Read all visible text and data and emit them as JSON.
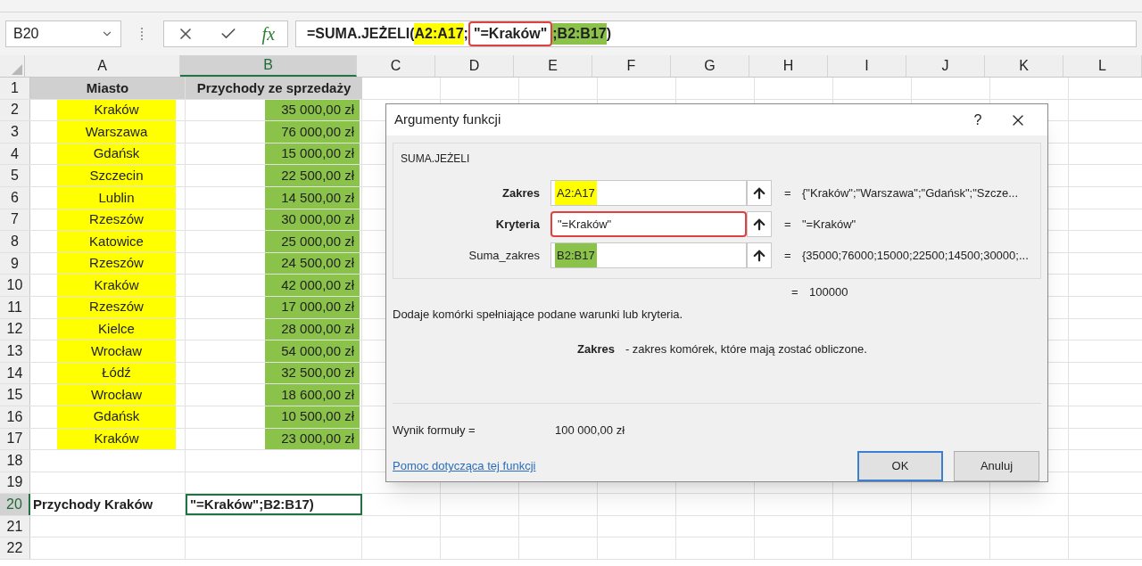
{
  "formula_bar": {
    "name_box": "B20",
    "fx": "fx",
    "formula": [
      {
        "text": "=SUMA.JEŻELI(",
        "kind": "plain"
      },
      {
        "text": "A2:A17",
        "kind": "yellow"
      },
      {
        "text": ";",
        "kind": "plain"
      },
      {
        "text": "\"=Kraków\"",
        "kind": "outlined"
      },
      {
        "text": ";B2:B17",
        "kind": "green"
      },
      {
        "text": ")",
        "kind": "plain"
      }
    ]
  },
  "columns": [
    {
      "label": "A",
      "selected": false
    },
    {
      "label": "B",
      "selected": true
    },
    {
      "label": "C",
      "selected": false
    },
    {
      "label": "D",
      "selected": false
    },
    {
      "label": "E",
      "selected": false
    },
    {
      "label": "F",
      "selected": false
    },
    {
      "label": "G",
      "selected": false
    },
    {
      "label": "H",
      "selected": false
    },
    {
      "label": "I",
      "selected": false
    },
    {
      "label": "J",
      "selected": false
    },
    {
      "label": "K",
      "selected": false
    },
    {
      "label": "L",
      "selected": false
    }
  ],
  "rows": [
    {
      "row": "1",
      "kind": "header",
      "selected": false,
      "a": "Miasto",
      "b": "Przychody ze sprzedaży"
    },
    {
      "row": "2",
      "kind": "data",
      "selected": false,
      "a": "Kraków",
      "b": "35 000,00 zł"
    },
    {
      "row": "3",
      "kind": "data",
      "selected": false,
      "a": "Warszawa",
      "b": "76 000,00 zł"
    },
    {
      "row": "4",
      "kind": "data",
      "selected": false,
      "a": "Gdańsk",
      "b": "15 000,00 zł"
    },
    {
      "row": "5",
      "kind": "data",
      "selected": false,
      "a": "Szczecin",
      "b": "22 500,00 zł"
    },
    {
      "row": "6",
      "kind": "data",
      "selected": false,
      "a": "Lublin",
      "b": "14 500,00 zł"
    },
    {
      "row": "7",
      "kind": "data",
      "selected": false,
      "a": "Rzeszów",
      "b": "30 000,00 zł"
    },
    {
      "row": "8",
      "kind": "data",
      "selected": false,
      "a": "Katowice",
      "b": "25 000,00 zł"
    },
    {
      "row": "9",
      "kind": "data",
      "selected": false,
      "a": "Rzeszów",
      "b": "24 500,00 zł"
    },
    {
      "row": "10",
      "kind": "data",
      "selected": false,
      "a": "Kraków",
      "b": "42 000,00 zł"
    },
    {
      "row": "11",
      "kind": "data",
      "selected": false,
      "a": "Rzeszów",
      "b": "17 000,00 zł"
    },
    {
      "row": "12",
      "kind": "data",
      "selected": false,
      "a": "Kielce",
      "b": "28 000,00 zł"
    },
    {
      "row": "13",
      "kind": "data",
      "selected": false,
      "a": "Wrocław",
      "b": "54 000,00 zł"
    },
    {
      "row": "14",
      "kind": "data",
      "selected": false,
      "a": "Łódź",
      "b": "32 500,00 zł"
    },
    {
      "row": "15",
      "kind": "data",
      "selected": false,
      "a": "Wrocław",
      "b": "18 600,00 zł"
    },
    {
      "row": "16",
      "kind": "data",
      "selected": false,
      "a": "Gdańsk",
      "b": "10 500,00 zł"
    },
    {
      "row": "17",
      "kind": "data",
      "selected": false,
      "a": "Kraków",
      "b": "23 000,00 zł"
    },
    {
      "row": "18",
      "kind": "empty",
      "selected": false
    },
    {
      "row": "19",
      "kind": "empty",
      "selected": false
    },
    {
      "row": "20",
      "kind": "total",
      "selected": true,
      "a": "Przychody Kraków",
      "b": "\"=Kraków\";B2:B17)"
    },
    {
      "row": "21",
      "kind": "empty",
      "selected": false
    },
    {
      "row": "22",
      "kind": "empty",
      "selected": false
    }
  ],
  "dialog": {
    "title": "Argumenty funkcji",
    "help": "?",
    "function_name": "SUMA.JEŻELI",
    "arguments": [
      {
        "label": "Zakres",
        "bold": true,
        "value": "A2:A17",
        "kind": "yellow",
        "equals": "=",
        "result": "{\"Kraków\";\"Warszawa\";\"Gdańsk\";\"Szcze..."
      },
      {
        "label": "Kryteria",
        "bold": true,
        "value": "\"=Kraków\"",
        "kind": "outlined",
        "equals": "=",
        "result": "\"=Kraków\""
      },
      {
        "label": "Suma_zakres",
        "bold": false,
        "value": "B2:B17",
        "kind": "green",
        "equals": "=",
        "result": "{35000;76000;15000;22500;14500;30000;..."
      }
    ],
    "total_equals": "=",
    "total": "100000",
    "description": "Dodaje komórki spełniające podane warunki lub kryteria.",
    "arg_help_label": "Zakres",
    "arg_help": "- zakres komórek, które mają zostać obliczone.",
    "result_label": "Wynik formuły =",
    "result_value": "100 000,00 zł",
    "help_link": "Pomoc dotycząca tej funkcji",
    "buttons": [
      {
        "label": "OK",
        "default": true
      },
      {
        "label": "Anuluj",
        "default": false
      }
    ]
  }
}
